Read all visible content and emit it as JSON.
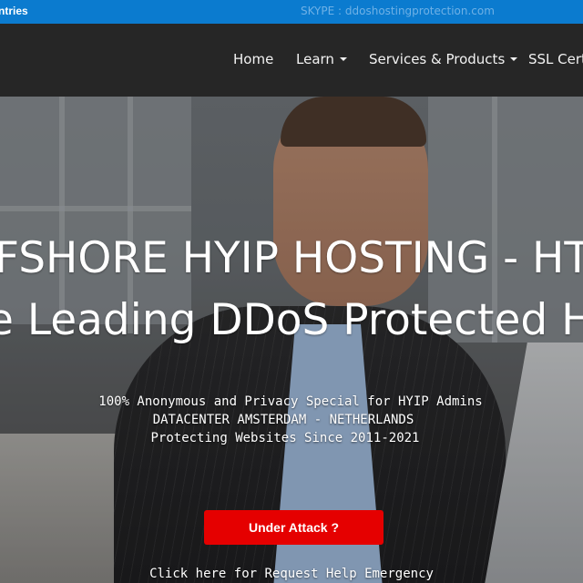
{
  "topbar": {
    "left_text": "ntries",
    "skype_text": "SKYPE : ddoshostingprotection.com"
  },
  "nav": {
    "items": [
      {
        "label": "Home",
        "dropdown": false
      },
      {
        "label": "Learn",
        "dropdown": true
      },
      {
        "label": "Services & Products",
        "dropdown": true
      },
      {
        "label": "SSL Certi",
        "dropdown": false
      }
    ]
  },
  "hero": {
    "headline_1": "FSHORE HYIP HOSTING - HTTP",
    "headline_2": "e Leading DDoS Protected Hosti",
    "subtext_1": "100% Anonymous and Privacy Special for HYIP Admins",
    "subtext_2": "DATACENTER AMSTERDAM - NETHERLANDS",
    "subtext_3": "Protecting Websites Since 2011-2021",
    "attack_button": "Under Attack ?",
    "help_link": "Click here for Request Help Emergency"
  },
  "colors": {
    "topbar_bg": "#0b7bcf",
    "navbar_bg": "#262626",
    "attack_button_bg": "#e50000"
  }
}
